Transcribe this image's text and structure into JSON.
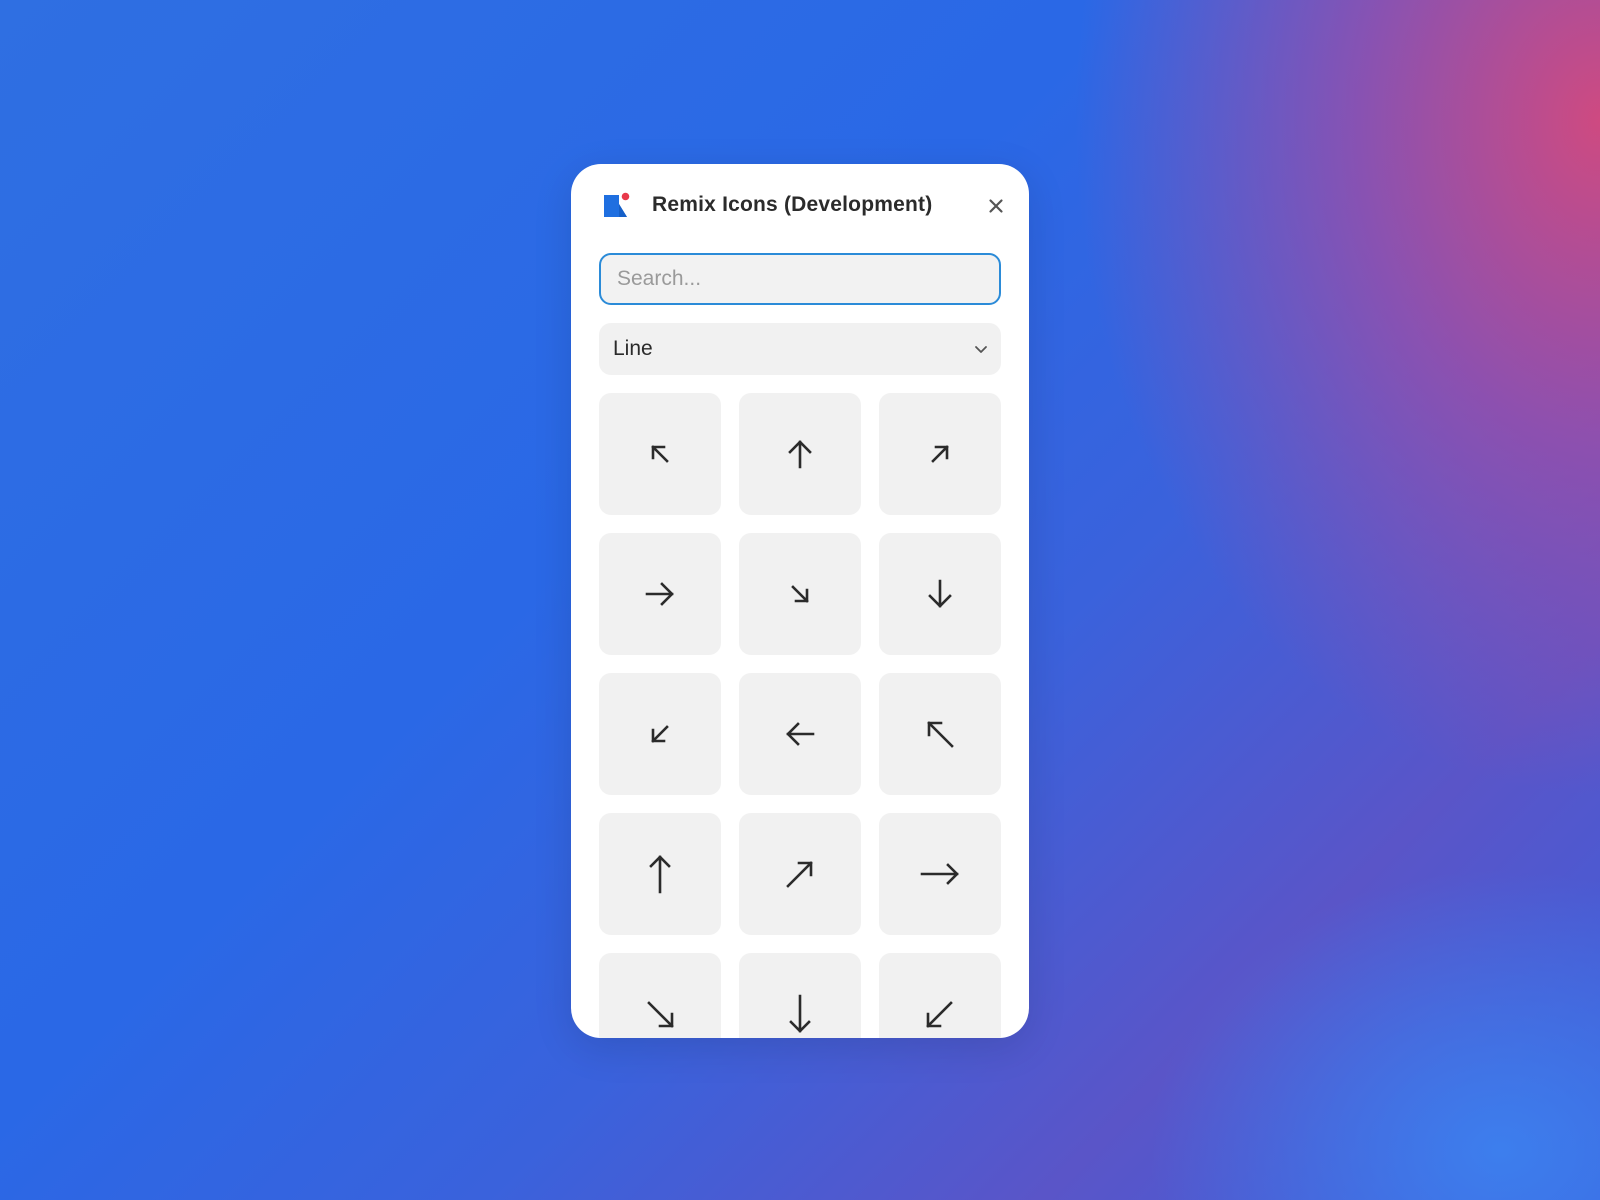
{
  "window": {
    "title": "Remix Icons (Development)",
    "close_icon": "close-icon",
    "logo_icon": "remix-logo-icon"
  },
  "search": {
    "placeholder": "Search...",
    "value": ""
  },
  "style_select": {
    "selected": "Line",
    "icon": "chevron-down-icon"
  },
  "icons": [
    {
      "name": "arrow-left-up-icon"
    },
    {
      "name": "arrow-up-icon"
    },
    {
      "name": "arrow-right-up-icon"
    },
    {
      "name": "arrow-right-icon"
    },
    {
      "name": "arrow-right-down-icon"
    },
    {
      "name": "arrow-down-icon"
    },
    {
      "name": "arrow-left-down-icon"
    },
    {
      "name": "arrow-left-icon"
    },
    {
      "name": "arrow-left-up-long-icon"
    },
    {
      "name": "arrow-up-long-icon"
    },
    {
      "name": "arrow-right-up-long-icon"
    },
    {
      "name": "arrow-right-long-icon"
    },
    {
      "name": "arrow-right-down-long-icon"
    },
    {
      "name": "arrow-down-long-icon"
    },
    {
      "name": "arrow-left-down-long-icon"
    }
  ],
  "colors": {
    "accent": "#2b8bd8",
    "logo_blue": "#1f6fe0",
    "logo_dot": "#e8394a",
    "tile_bg": "#f1f1f1",
    "icon_stroke": "#2b2b2b"
  }
}
